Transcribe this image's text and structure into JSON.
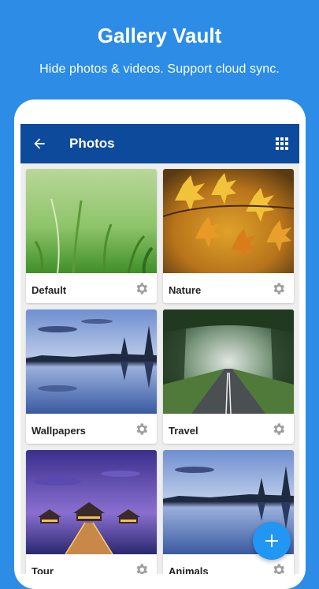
{
  "promo": {
    "title": "Gallery Vault",
    "subtitle": "Hide photos & videos. Support cloud sync."
  },
  "appbar": {
    "title": "Photos",
    "back_icon": "arrow-left",
    "layout_icon": "grid-view"
  },
  "albums": [
    {
      "label": "Default"
    },
    {
      "label": "Nature"
    },
    {
      "label": "Wallpapers"
    },
    {
      "label": "Travel"
    },
    {
      "label": "Tour"
    },
    {
      "label": "Animals"
    }
  ],
  "fab": {
    "icon": "plus"
  },
  "colors": {
    "background": "#2c8ce6",
    "appbar": "#0e4a9c",
    "fab": "#2196f3"
  }
}
